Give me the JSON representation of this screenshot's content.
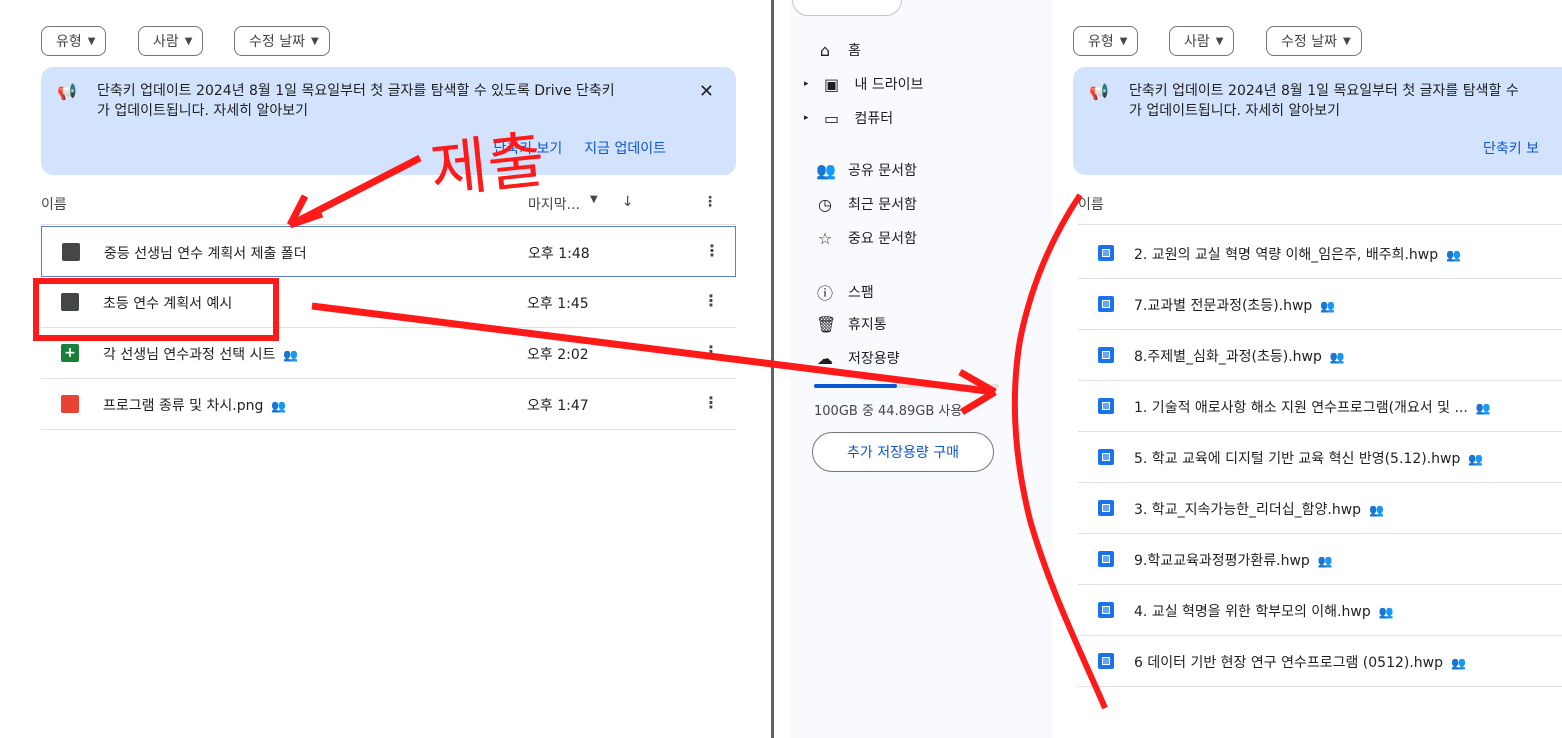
{
  "filters": {
    "type": "유형",
    "people": "사람",
    "modified": "수정 날짜"
  },
  "banner": {
    "line1": "단축키 업데이트 2024년 8월 1일 목요일부터 첫 글자를 탐색할 수 있도록 Drive 단축키",
    "line2": "가 업데이트됩니다. 자세히 알아보기",
    "view_shortcuts": "단축키 보기",
    "view_updates": "지금 업데이트",
    "right_line1": "단축키 업데이트 2024년 8월 1일 목요일부터 첫 글자를 탐색할 수",
    "right_line2": "가 업데이트됩니다. 자세히 알아보기",
    "right_view": "단축키 보"
  },
  "header": {
    "name": "이름",
    "modified": "마지막..."
  },
  "left_files": [
    {
      "name": "중등 선생님 연수 계획서 제출 폴더",
      "time": "오후 1:48"
    },
    {
      "name": "초등 연수 계획서 예시",
      "time": "오후 1:45"
    },
    {
      "name": "각 선생님 연수과정 선택 시트",
      "time": "오후 2:02"
    },
    {
      "name": "프로그램 종류 및 차시.png",
      "time": "오후 1:47"
    }
  ],
  "nav": {
    "home": "홈",
    "my_drive": "내 드라이브",
    "computers": "컴퓨터",
    "shared": "공유 문서함",
    "recent": "최근 문서함",
    "starred": "중요 문서함",
    "spam": "스팸",
    "trash": "휴지통",
    "storage": "저장용량"
  },
  "storage": {
    "text": "100GB 중 44.89GB 사용",
    "used_fraction": 0.45,
    "buy": "추가 저장용량 구매"
  },
  "right_files": [
    "2. 교원의 교실 혁명 역량 이해_임은주, 배주희.hwp",
    "7.교과별 전문과정(초등).hwp",
    "8.주제별_심화_과정(초등).hwp",
    "1. 기술적 애로사항 해소 지원 연수프로그램(개요서 및 ...",
    "5. 학교 교육에 디지털 기반 교육 혁신 반영(5.12).hwp",
    "3. 학교_지속가능한_리더십_함양.hwp",
    "9.학교교육과정평가환류.hwp",
    "4. 교실 혁명을 위한 학부모의 이해.hwp",
    "6 데이터 기반 현장 연구 연수프로그램 (0512).hwp"
  ],
  "annotation": {
    "handwriting": "제출"
  },
  "colors": {
    "banner_bg": "#d3e3fd",
    "accent": "#0b57d0",
    "annotation_red": "#ff1a1a"
  }
}
